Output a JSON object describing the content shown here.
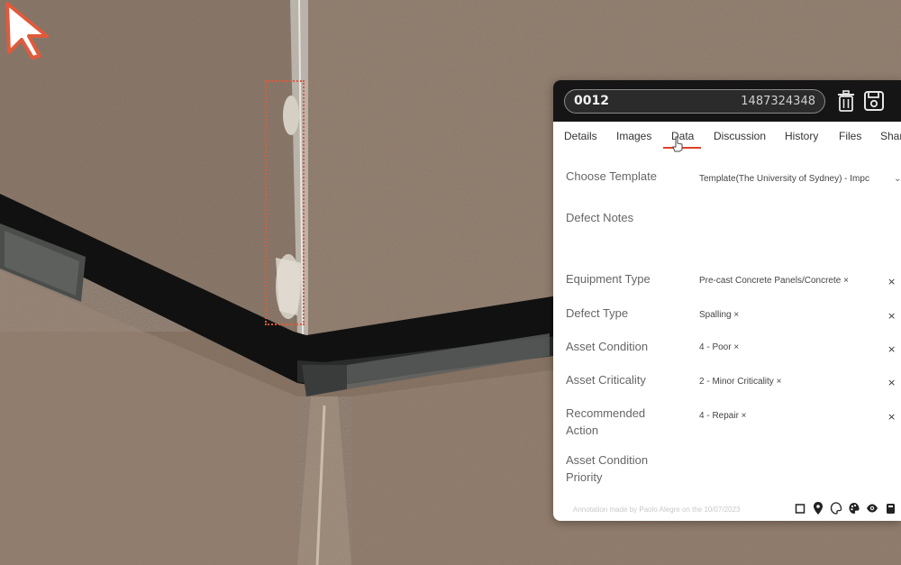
{
  "annotation": {
    "id": "0012",
    "number": "1487324348"
  },
  "tabs": [
    {
      "label": "Details"
    },
    {
      "label": "Images"
    },
    {
      "label": "Data"
    },
    {
      "label": "Discussion"
    },
    {
      "label": "History"
    },
    {
      "label": "Files"
    },
    {
      "label": "Shar"
    }
  ],
  "active_tab": "Data",
  "fields": {
    "template": {
      "label": "Choose Template",
      "value": "Template(The University of Sydney) - Impc"
    },
    "defect_notes": {
      "label": "Defect Notes",
      "value": ""
    },
    "equipment_type": {
      "label": "Equipment Type",
      "value": "Pre-cast Concrete Panels/Concrete ×"
    },
    "defect_type": {
      "label": "Defect Type",
      "value": "Spalling ×"
    },
    "asset_condition": {
      "label": "Asset Condition",
      "value": "4 - Poor ×"
    },
    "asset_criticality": {
      "label": "Asset Criticality",
      "value": "2 - Minor Criticality ×"
    },
    "recommended_action": {
      "label_line1": "Recommended",
      "label_line2": "Action",
      "value": "4 - Repair ×"
    },
    "asset_condition_priority": {
      "label_line1": "Asset Condition",
      "label_line2": "Priority"
    }
  },
  "remove_glyph": "×",
  "footer": {
    "text": "Annotation made by Paolo Alegre on the 10/07/2023"
  },
  "colors": {
    "accent": "#e0402a",
    "annotation_outline": "#e0583a",
    "header_bg": "#151515"
  },
  "icons": [
    "trash-icon",
    "save-icon",
    "square-icon",
    "location-pin-icon",
    "palette-outline-icon",
    "palette-icon",
    "eye-icon",
    "more-icon"
  ]
}
